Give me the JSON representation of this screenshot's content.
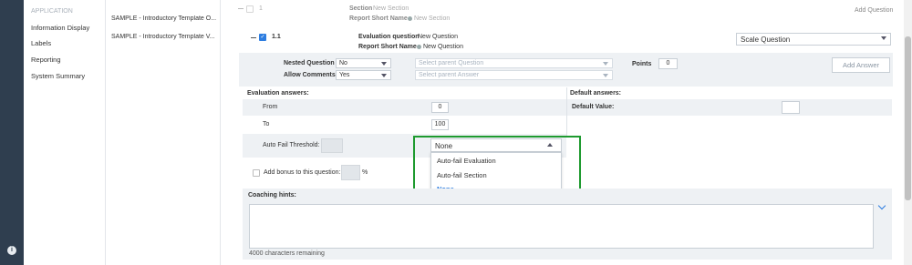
{
  "nav": {
    "section_header": "APPLICATION",
    "items": [
      "Information Display",
      "Labels",
      "Reporting",
      "System Summary"
    ]
  },
  "templates": {
    "items": [
      "SAMPLE - Introductory Template O...",
      "SAMPLE - Introductory Template V..."
    ]
  },
  "section_row": {
    "number": "1",
    "section_label": "Section",
    "section_value": "New Section",
    "short_name_label": "Report Short Name",
    "short_name_value": "New Section",
    "add_question": "Add Question"
  },
  "question": {
    "number": "1.1",
    "eval_label": "Evaluation question",
    "eval_value": "New Question",
    "short_name_label": "Report Short Name",
    "short_name_value": "New Question",
    "type_select": "Scale Question"
  },
  "options": {
    "nested_label": "Nested Question",
    "nested_value": "No",
    "parent_question_placeholder": "Select parent Question",
    "allow_comments_label": "Allow Comments",
    "allow_comments_value": "Yes",
    "parent_answer_placeholder": "Select parent Answer",
    "points_label": "Points",
    "points_value": "0",
    "add_answer": "Add Answer"
  },
  "eval_answers": {
    "header": "Evaluation answers:",
    "from_label": "From",
    "from_value": "0",
    "to_label": "To",
    "to_value": "100",
    "auto_fail_label": "Auto Fail Threshold:",
    "auto_fail_selected": "None",
    "dropdown_options": [
      "Auto-fail Evaluation",
      "Auto-fail Section",
      "None"
    ],
    "bonus_label": "Add bonus to this question:",
    "bonus_unit": "%"
  },
  "default_answers": {
    "header": "Default answers:",
    "default_value_label": "Default Value:"
  },
  "coaching": {
    "header": "Coaching hints:",
    "remaining": "4000 characters remaining"
  },
  "colors": {
    "rail": "#2f3e4f",
    "accent": "#2d7de0",
    "highlight": "#1e9a2f"
  }
}
